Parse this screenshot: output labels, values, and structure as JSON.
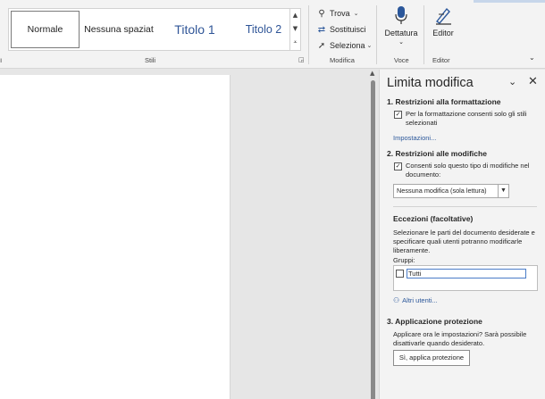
{
  "ribbon": {
    "styles": {
      "items": [
        "Normale",
        "Nessuna spaziat",
        "Titolo 1",
        "Titolo 2"
      ],
      "group_label": "Stili"
    },
    "modifica": {
      "trova": "Trova",
      "sostituisci": "Sostituisci",
      "seleziona": "Seleziona",
      "group_label": "Modifica"
    },
    "voce": {
      "button": "Dettatura",
      "group_label": "Voce"
    },
    "editor": {
      "button": "Editor",
      "group_label": "Editor"
    }
  },
  "pane": {
    "title": "Limita modifica",
    "section1": {
      "heading": "1. Restrizioni alla formattazione",
      "checkbox_label": "Per la formattazione consenti solo gli stili selezionati",
      "checked": true,
      "link": "Impostazioni..."
    },
    "section2": {
      "heading": "2. Restrizioni alle modifiche",
      "checkbox_label": "Consenti solo questo tipo di modifiche nel documento:",
      "checked": true,
      "select_value": "Nessuna modifica (sola lettura)"
    },
    "exceptions": {
      "heading": "Eccezioni (facoltative)",
      "description": "Selezionare le parti del documento desiderate e specificare quali utenti potranno modificarle liberamente.",
      "groups_label": "Gruppi:",
      "groups": [
        {
          "name": "Tutti",
          "checked": false
        }
      ],
      "more_users_link": "Altri utenti..."
    },
    "section3": {
      "heading": "3. Applicazione protezione",
      "description": "Applicare ora le impostazioni? Sarà possibile disattivarle quando desiderato.",
      "button": "Sì, applica protezione"
    }
  },
  "colors": {
    "accent": "#2b579a",
    "heading_style": "#2f5597",
    "pane_bg": "#f3f3f3",
    "ribbon_bg": "#f3f3f3"
  }
}
